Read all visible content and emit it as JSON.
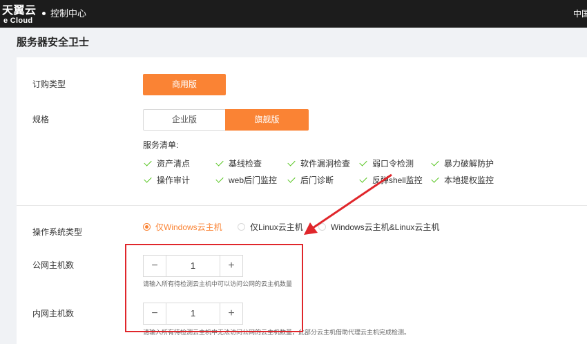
{
  "header": {
    "logo_cn": "天翼云",
    "logo_en": "e Cloud",
    "console_label": "控制中心",
    "region_label": "中国"
  },
  "page": {
    "title": "服务器安全卫士"
  },
  "purchase_type": {
    "label": "订购类型",
    "option": "商用版"
  },
  "spec": {
    "label": "规格",
    "options": [
      "企业版",
      "旗舰版"
    ],
    "selected": "旗舰版"
  },
  "services": {
    "title": "服务清单:",
    "items": [
      "资产清点",
      "基线检查",
      "软件漏洞检查",
      "弱口令检测",
      "暴力破解防护",
      "操作审计",
      "web后门监控",
      "后门诊断",
      "反弹shell监控",
      "本地提权监控"
    ]
  },
  "os_type": {
    "label": "操作系统类型",
    "options": [
      "仅Windows云主机",
      "仅Linux云主机",
      "Windows云主机&Linux云主机"
    ],
    "selected": "仅Windows云主机"
  },
  "public_hosts": {
    "label": "公网主机数",
    "value": "1",
    "hint": "请输入所有待检测云主机中可以访问公网的云主机数量"
  },
  "private_hosts": {
    "label": "内网主机数",
    "value": "1",
    "hint": "请输入所有待检测云主机中无法访问公网的云主机数量，此部分云主机借助代理云主机完成检测。"
  },
  "colors": {
    "accent": "#fa8334",
    "check": "#52c41a",
    "annotation": "#e0262b",
    "topbar": "#1c1c1c"
  }
}
